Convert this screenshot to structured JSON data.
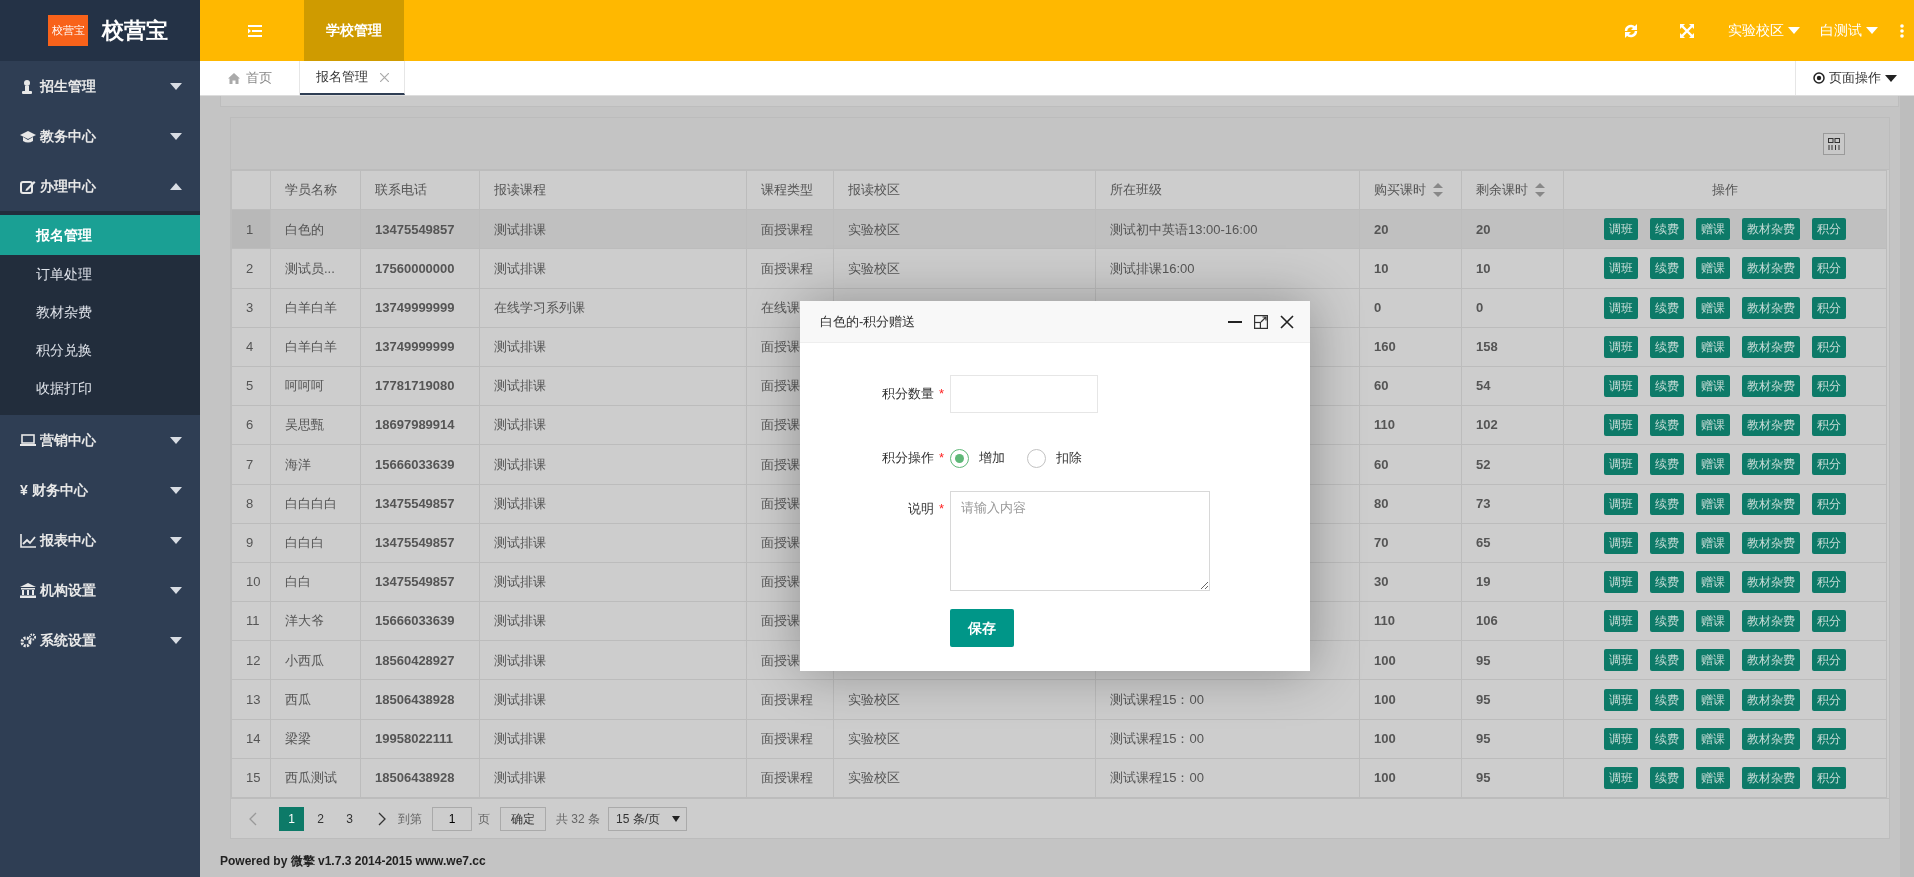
{
  "app": {
    "logo_badge": "校营宝",
    "logo_text": "校营宝"
  },
  "header": {
    "nav": [
      {
        "label": "学校管理",
        "selected": true
      }
    ],
    "campus": "实验校区",
    "user": "白测试"
  },
  "sidebar": {
    "items": [
      {
        "label": "招生管理",
        "expanded": false
      },
      {
        "label": "教务中心",
        "expanded": false
      },
      {
        "label": "办理中心",
        "expanded": true,
        "children": [
          {
            "label": "报名管理",
            "selected": true
          },
          {
            "label": "订单处理",
            "selected": false
          },
          {
            "label": "教材杂费",
            "selected": false
          },
          {
            "label": "积分兑换",
            "selected": false
          },
          {
            "label": "收据打印",
            "selected": false
          }
        ]
      },
      {
        "label": "营销中心",
        "expanded": false
      },
      {
        "label": "财务中心",
        "icon_text": "¥",
        "expanded": false
      },
      {
        "label": "报表中心",
        "expanded": false
      },
      {
        "label": "机构设置",
        "expanded": false
      },
      {
        "label": "系统设置",
        "expanded": false
      }
    ]
  },
  "tabs": [
    {
      "label": "首页",
      "selected": false,
      "closable": false
    },
    {
      "label": "报名管理",
      "selected": true,
      "closable": true
    }
  ],
  "page_actions": "页面操作",
  "table": {
    "columns": [
      {
        "label": "学员名称",
        "sortable": false
      },
      {
        "label": "联系电话",
        "sortable": false
      },
      {
        "label": "报读课程",
        "sortable": false
      },
      {
        "label": "课程类型",
        "sortable": false
      },
      {
        "label": "报读校区",
        "sortable": false
      },
      {
        "label": "所在班级",
        "sortable": false
      },
      {
        "label": "购买课时",
        "sortable": true
      },
      {
        "label": "剩余课时",
        "sortable": true
      },
      {
        "label": "操作",
        "sortable": false
      }
    ],
    "rows": [
      {
        "index": "1",
        "hovered": true,
        "name": "白色的",
        "phone": "13475549857",
        "course": "测试排课",
        "type": "面授课程",
        "campus": "实验校区",
        "class": "测试初中英语13:00-16:00",
        "bought": "20",
        "remaining": "20",
        "actions": [
          "调班",
          "续费",
          "赠课",
          "教材杂费",
          "积分"
        ]
      },
      {
        "index": "2",
        "hovered": false,
        "name": "测试员...",
        "phone": "17560000000",
        "course": "测试排课",
        "type": "面授课程",
        "campus": "实验校区",
        "class": "测试排课16:00",
        "bought": "10",
        "remaining": "10",
        "actions": [
          "调班",
          "续费",
          "赠课",
          "教材杂费",
          "积分"
        ]
      },
      {
        "index": "3",
        "hovered": false,
        "name": "白羊白羊",
        "phone": "13749999999",
        "course": "在线学习系列课",
        "type": "在线课",
        "bought": "0",
        "remaining": "0",
        "actions": [
          "调班",
          "续费",
          "赠课",
          "教材杂费",
          "积分"
        ]
      },
      {
        "index": "4",
        "hovered": false,
        "name": "白羊白羊",
        "phone": "13749999999",
        "course": "测试排课",
        "type": "面授课",
        "bought": "160",
        "remaining": "158",
        "actions": [
          "调班",
          "续费",
          "赠课",
          "教材杂费",
          "积分"
        ]
      },
      {
        "index": "5",
        "hovered": false,
        "name": "呵呵呵",
        "phone": "17781719080",
        "course": "测试排课",
        "type": "面授课",
        "bought": "60",
        "remaining": "54",
        "actions": [
          "调班",
          "续费",
          "赠课",
          "教材杂费",
          "积分"
        ]
      },
      {
        "index": "6",
        "hovered": false,
        "name": "吴思甄",
        "phone": "18697989914",
        "course": "测试排课",
        "type": "面授课",
        "bought": "110",
        "remaining": "102",
        "actions": [
          "调班",
          "续费",
          "赠课",
          "教材杂费",
          "积分"
        ]
      },
      {
        "index": "7",
        "hovered": false,
        "name": "海洋",
        "phone": "15666033639",
        "course": "测试排课",
        "type": "面授课",
        "bought": "60",
        "remaining": "52",
        "actions": [
          "调班",
          "续费",
          "赠课",
          "教材杂费",
          "积分"
        ]
      },
      {
        "index": "8",
        "hovered": false,
        "name": "白白白白",
        "phone": "13475549857",
        "course": "测试排课",
        "type": "面授课",
        "bought": "80",
        "remaining": "73",
        "actions": [
          "调班",
          "续费",
          "赠课",
          "教材杂费",
          "积分"
        ]
      },
      {
        "index": "9",
        "hovered": false,
        "name": "白白白",
        "phone": "13475549857",
        "course": "测试排课",
        "type": "面授课",
        "bought": "70",
        "remaining": "65",
        "actions": [
          "调班",
          "续费",
          "赠课",
          "教材杂费",
          "积分"
        ]
      },
      {
        "index": "10",
        "hovered": false,
        "name": "白白",
        "phone": "13475549857",
        "course": "测试排课",
        "type": "面授课",
        "bought": "30",
        "remaining": "19",
        "actions": [
          "调班",
          "续费",
          "赠课",
          "教材杂费",
          "积分"
        ]
      },
      {
        "index": "11",
        "hovered": false,
        "name": "洋大爷",
        "phone": "15666033639",
        "course": "测试排课",
        "type": "面授课",
        "bought": "110",
        "remaining": "106",
        "actions": [
          "调班",
          "续费",
          "赠课",
          "教材杂费",
          "积分"
        ]
      },
      {
        "index": "12",
        "hovered": false,
        "name": "小西瓜",
        "phone": "18560428927",
        "course": "测试排课",
        "type": "面授课",
        "bought": "100",
        "remaining": "95",
        "actions": [
          "调班",
          "续费",
          "赠课",
          "教材杂费",
          "积分"
        ]
      },
      {
        "index": "13",
        "hovered": false,
        "name": "西瓜",
        "phone": "18506438928",
        "course": "测试排课",
        "type": "面授课程",
        "campus": "实验校区",
        "class": "测试课程15：00",
        "bought": "100",
        "remaining": "95",
        "actions": [
          "调班",
          "续费",
          "赠课",
          "教材杂费",
          "积分"
        ]
      },
      {
        "index": "14",
        "hovered": false,
        "name": "梁梁",
        "phone": "19958022111",
        "course": "测试排课",
        "type": "面授课程",
        "campus": "实验校区",
        "class": "测试课程15：00",
        "bought": "100",
        "remaining": "95",
        "actions": [
          "调班",
          "续费",
          "赠课",
          "教材杂费",
          "积分"
        ]
      },
      {
        "index": "15",
        "hovered": false,
        "name": "西瓜测试",
        "phone": "18506438928",
        "course": "测试排课",
        "type": "面授课程",
        "campus": "实验校区",
        "class": "测试课程15：00",
        "bought": "100",
        "remaining": "95",
        "actions": [
          "调班",
          "续费",
          "赠课",
          "教材杂费",
          "积分"
        ]
      }
    ]
  },
  "pagination": {
    "pages": [
      {
        "label": "1",
        "selected": true
      },
      {
        "label": "2",
        "selected": false
      },
      {
        "label": "3",
        "selected": false
      }
    ],
    "goto_label": "到第",
    "goto_value": "1",
    "page_unit": "页",
    "confirm": "确定",
    "total": "共 32 条",
    "page_size": "15 条/页"
  },
  "footer": "Powered by 微擎 v1.7.3 2014-2015 www.we7.cc",
  "dialog": {
    "title": "白色的-积分赠送",
    "fields": [
      {
        "kind": "text",
        "label": "积分数量",
        "required_mark": "*"
      },
      {
        "kind": "radio",
        "label": "积分操作",
        "required_mark": "*",
        "options": [
          {
            "label": "增加",
            "selected": true
          },
          {
            "label": "扣除",
            "selected": false
          }
        ]
      },
      {
        "kind": "textarea",
        "label": "说明",
        "required_mark": "*",
        "placeholder": "请输入内容"
      }
    ],
    "submit": "保存"
  }
}
